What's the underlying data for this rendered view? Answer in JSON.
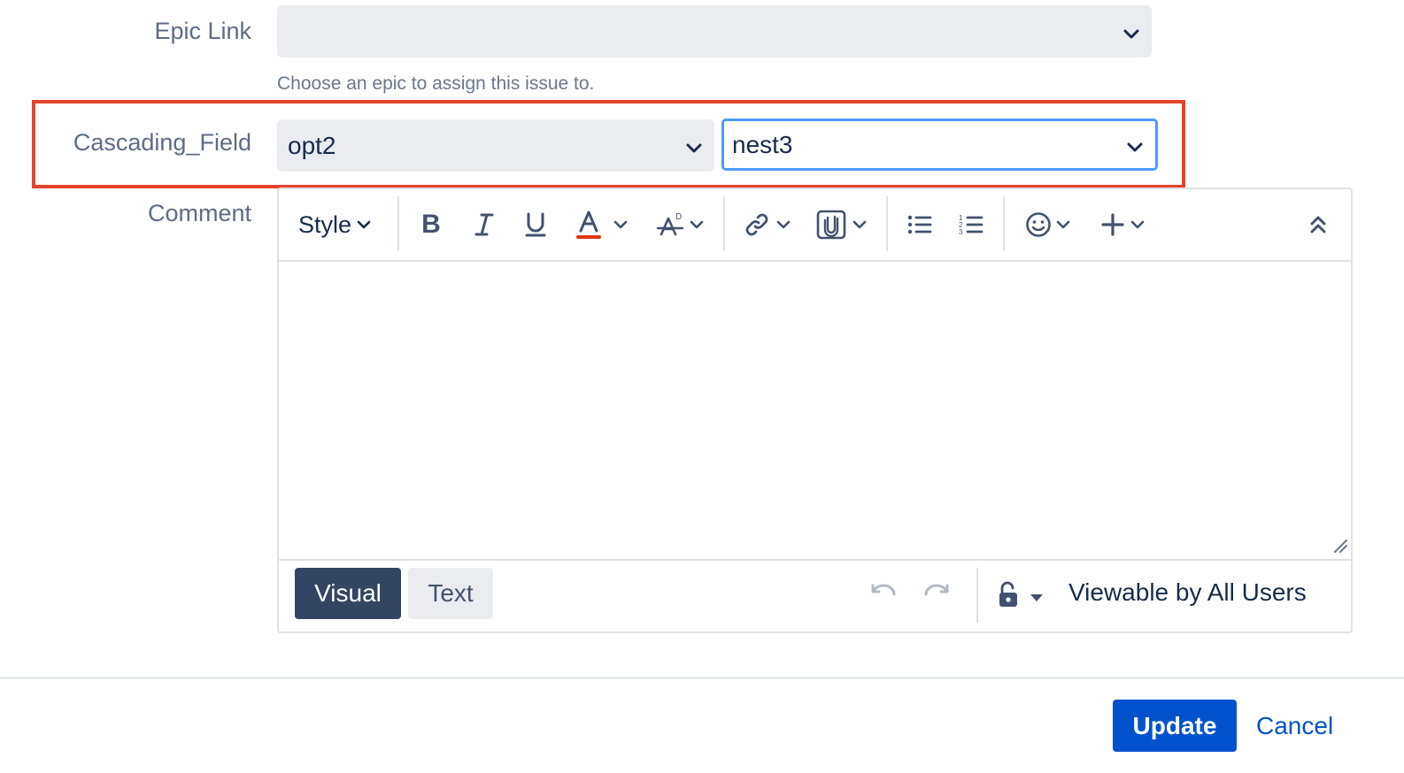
{
  "epic_link": {
    "label": "Epic Link",
    "value": "",
    "help": "Choose an epic to assign this issue to."
  },
  "cascading_field": {
    "label": "Cascading_Field",
    "parent_value": "opt2",
    "child_value": "nest3"
  },
  "comment": {
    "label": "Comment",
    "toolbar": {
      "style_label": "Style",
      "icons": [
        "bold-icon",
        "italic-icon",
        "underline-icon",
        "text-color-icon",
        "clear-format-icon",
        "link-icon",
        "attachment-icon",
        "bullet-list-icon",
        "numbered-list-icon",
        "emoji-icon",
        "insert-more-icon",
        "collapse-toolbar-icon"
      ]
    },
    "modes": {
      "visual": "Visual",
      "text": "Text"
    },
    "visibility": "Viewable by All Users"
  },
  "actions": {
    "update": "Update",
    "cancel": "Cancel"
  },
  "colors": {
    "accent": "#0052cc",
    "highlight": "#e5432b",
    "focus": "#4c9aff",
    "text_color_bar": "#de350b"
  }
}
